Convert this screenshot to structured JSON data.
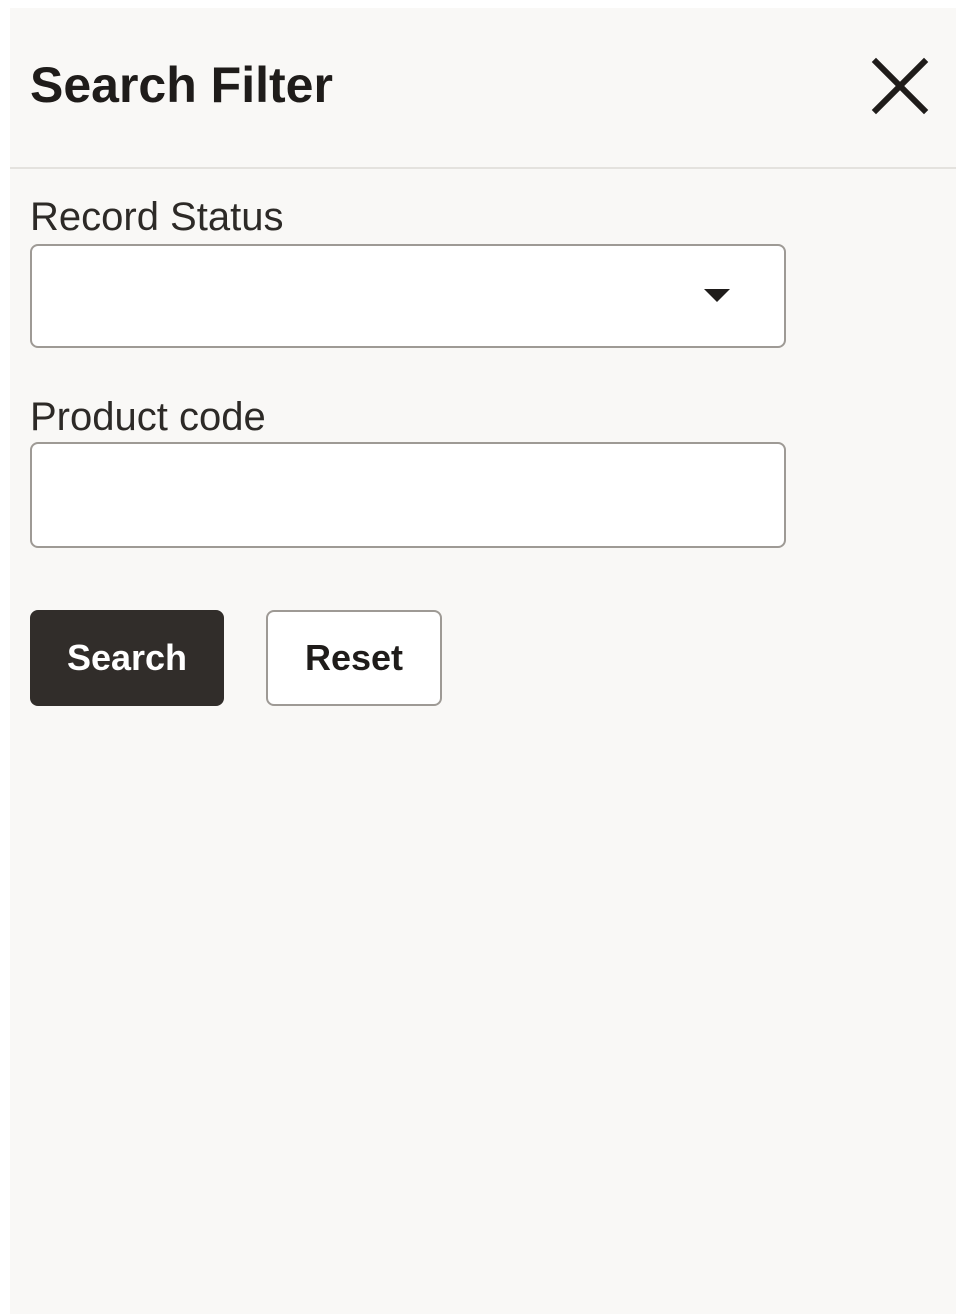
{
  "dialog": {
    "title": "Search Filter",
    "close_icon": "close-icon"
  },
  "fields": {
    "record_status": {
      "label": "Record Status",
      "value": "",
      "dropdown_icon": "caret-down-icon"
    },
    "product_code": {
      "label": "Product code",
      "value": "",
      "placeholder": ""
    }
  },
  "actions": {
    "search_label": "Search",
    "reset_label": "Reset"
  },
  "colors": {
    "panel_background": "#f9f8f6",
    "primary_button": "#312d2a",
    "border": "#9e9a95",
    "text": "#1f1c1a"
  }
}
